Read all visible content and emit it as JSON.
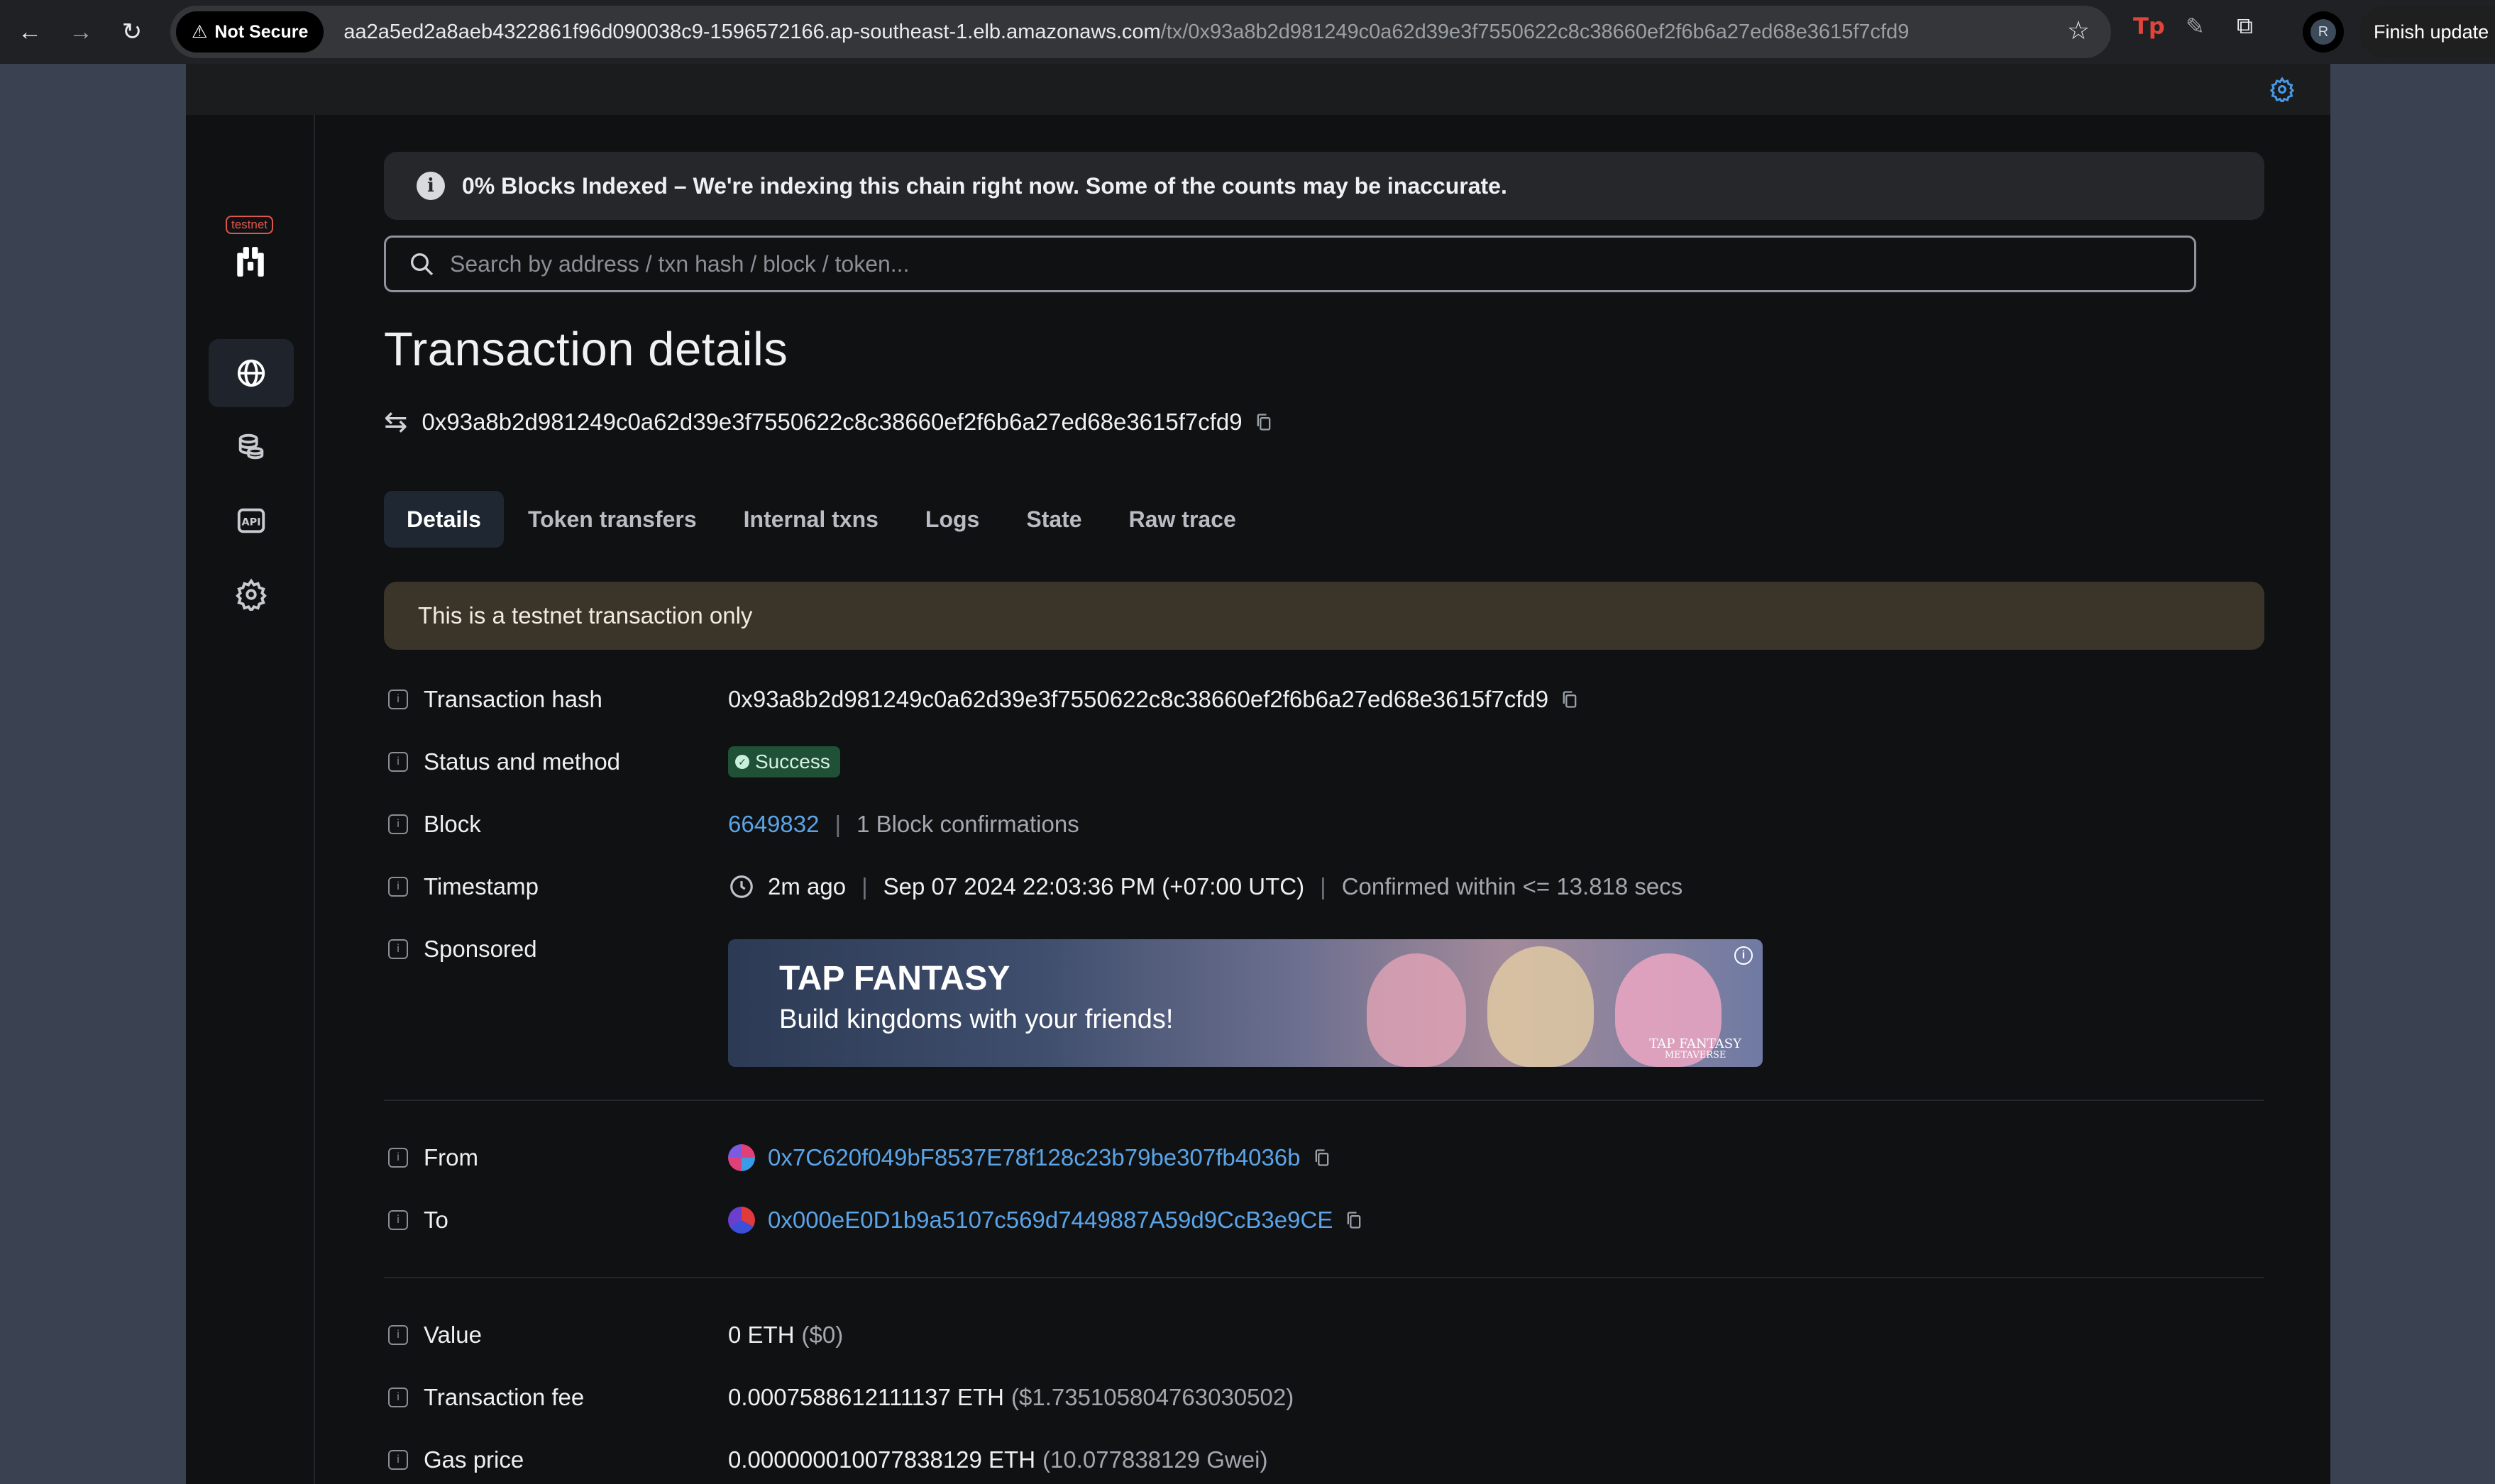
{
  "browser": {
    "security_label": "Not Secure",
    "url_host": "aa2a5ed2a8aeb4322861f96d090038c9-1596572166.ap-southeast-1.elb.amazonaws.com",
    "url_path": "/tx/0x93a8b2d981249c0a62d39e3f7550622c8c38660ef2f6b6a27ed68e3615f7cfd9",
    "profile_initial": "R",
    "finish_update_label": "Finish update"
  },
  "sidebar": {
    "network_tag": "testnet",
    "items": [
      {
        "name": "blockchain",
        "icon": "globe-icon",
        "active": true
      },
      {
        "name": "tokens",
        "icon": "coins-icon",
        "active": false
      },
      {
        "name": "api",
        "icon": "api-icon",
        "label": "API",
        "active": false
      },
      {
        "name": "other",
        "icon": "gear-icon",
        "active": false
      }
    ]
  },
  "banner": {
    "text": "0% Blocks Indexed – We're indexing this chain right now. Some of the counts may be inaccurate.",
    "icon": "info-icon"
  },
  "search": {
    "placeholder": "Search by address / txn hash / block / token..."
  },
  "page": {
    "title": "Transaction details",
    "tx_hash": "0x93a8b2d981249c0a62d39e3f7550622c8c38660ef2f6b6a27ed68e3615f7cfd9"
  },
  "tabs": [
    {
      "label": "Details",
      "active": true
    },
    {
      "label": "Token transfers",
      "active": false
    },
    {
      "label": "Internal txns",
      "active": false
    },
    {
      "label": "Logs",
      "active": false
    },
    {
      "label": "State",
      "active": false
    },
    {
      "label": "Raw trace",
      "active": false
    }
  ],
  "testnet_note": "This is a testnet transaction only",
  "details": {
    "tx_hash_label": "Transaction hash",
    "tx_hash_value": "0x93a8b2d981249c0a62d39e3f7550622c8c38660ef2f6b6a27ed68e3615f7cfd9",
    "status_label": "Status and method",
    "status_value": "Success",
    "block_label": "Block",
    "block_number": "6649832",
    "block_confirmations": "1 Block confirmations",
    "timestamp_label": "Timestamp",
    "timestamp_relative": "2m ago",
    "timestamp_absolute": "Sep 07 2024 22:03:36 PM (+07:00 UTC)",
    "timestamp_confirmed": "Confirmed within <= 13.818 secs",
    "sponsored_label": "Sponsored",
    "from_label": "From",
    "from_address": "0x7C620f049bF8537E78f128c23b79be307fb4036b",
    "to_label": "To",
    "to_address": "0x000eE0D1b9a5107c569d7449887A59d9CcB3e9CE",
    "value_label": "Value",
    "value_main": "0 ETH",
    "value_usd": "($0)",
    "fee_label": "Transaction fee",
    "fee_main": "0.0007588612111137 ETH",
    "fee_usd": "($1.735105804763030502)",
    "gas_label": "Gas price",
    "gas_main": "0.000000010077838129 ETH",
    "gas_gwei": "(10.077838129 Gwei)"
  },
  "ad": {
    "title": "TAP FANTASY",
    "tagline": "Build kingdoms with your friends!",
    "brand_line1": "TAP FANTASY",
    "brand_line2": "METAVERSE"
  },
  "colors": {
    "accent": "#5ba4e8",
    "success_bg": "#1f5136",
    "warning_bg": "#3b3428"
  }
}
